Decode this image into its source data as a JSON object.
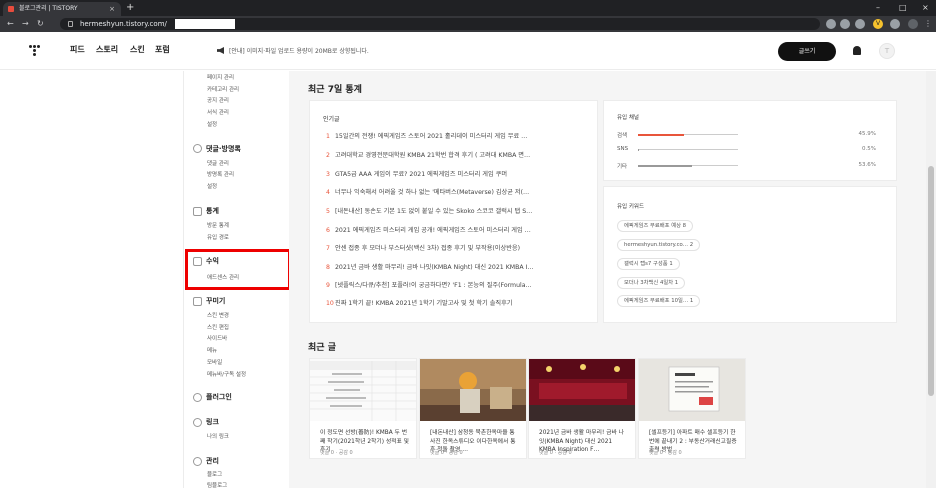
{
  "browser": {
    "tab_title": "블로그관리 | TISTORY",
    "tab_close": "×",
    "new_tab": "+",
    "url": "hermeshyun.tistory.com/",
    "win_min": "–",
    "win_max": "□",
    "win_close": "×"
  },
  "nav": {
    "items": [
      "피드",
      "스토리",
      "스킨",
      "포럼"
    ],
    "notice": "[안내] 이미지·파일 업로드 용량이 20MB로 상향됩니다.",
    "write_label": "글쓰기",
    "avatar_text": "T"
  },
  "sidebar": {
    "top_items": [
      "페이지 관리",
      "카테고리 관리",
      "공지 관리",
      "서식 관리",
      "설정"
    ],
    "comments": {
      "title": "댓글·방명록",
      "items": [
        "댓글 관리",
        "방명록 관리",
        "설정"
      ]
    },
    "stats": {
      "title": "통계",
      "items": [
        "방문 통계",
        "유입 경로"
      ]
    },
    "revenue": {
      "title": "수익",
      "items": [
        "애드센스 관리"
      ]
    },
    "decorate": {
      "title": "꾸미기",
      "items": [
        "스킨 변경",
        "스킨 편집",
        "사이드바",
        "메뉴",
        "모바일",
        "메뉴바/구독 설정"
      ]
    },
    "plugin": {
      "title": "플러그인"
    },
    "link": {
      "title": "링크",
      "items": [
        "나의 링크"
      ]
    },
    "manage": {
      "title": "관리",
      "items": [
        "블로그",
        "팀블로그"
      ]
    }
  },
  "stats_section": {
    "title": "최근 7일 통계",
    "popular_title": "인기글",
    "popular": [
      "15일간의 전쟁! 에픽게임즈 스토어 2021 홀리데이 미스터리 게임 무료 …",
      "고려대학교 경영전문대학원 KMBA 21학번 합격 후기 ( 고려대 KMBA 면…",
      "GTA5급 AAA 게임이 무료? 2021 에픽게임즈 미스터리 게임 쿠머",
      "너무나 익숙해서 어려울 것 하나 없는 '메타버스(Metaverse) 김상균 저(…",
      "[내돈내산] 동손도 기본 1도 없이 붙일 수 있는 Skoko 스코코 갤럭시 탭 S…",
      "2021 에픽게임즈 미스터리 게임 공개! 에픽게임즈 스토어 미스터리 게임 …",
      "안센 접종 후 모더나 부스터샷(백신 3차) 접종 후기 및 부작용(이상반응)",
      "2021년 금바 생활 마무리! 금바 나잇(KMBA Night) 대신 2021 KMBA I…",
      "[넷플릭스/다큐/추천] 포플러!이 궁금하다면? 'F1 : 본능의 질주(Formula…",
      "진짜 1학기 끝! KMBA 2021년 1학기 기말고사 및 첫 학기 솔직후기"
    ],
    "inflow_title": "유입 채널",
    "inflow": [
      {
        "label": "검색",
        "pct": "45.9%",
        "value": 45.9,
        "color": "#e8553b"
      },
      {
        "label": "SNS",
        "pct": "0.5%",
        "value": 0.5,
        "color": "#999999"
      },
      {
        "label": "기타",
        "pct": "53.6%",
        "value": 53.6,
        "color": "#999999"
      }
    ],
    "keywords_title": "유입 키워드",
    "keywords": [
      {
        "word": "에픽게임즈 무료배포 예상",
        "count": "8"
      },
      {
        "word": "hermeshyun.tistory.co…",
        "count": "2"
      },
      {
        "word": "갤럭시 탭s7 구성품",
        "count": "1"
      },
      {
        "word": "모더나 3차백신 4일차",
        "count": "1"
      },
      {
        "word": "에픽게임즈 무료배포 10일…",
        "count": "1"
      }
    ]
  },
  "recent_section": {
    "title": "최근 글",
    "posts": [
      {
        "title": "이 정도면 선방(善防)! KMBA 두 번째 학기(2021학년 2학기) 성적표 및 후기",
        "meta": "댓글 0 · 공감 0"
      },
      {
        "title": "[내돈내산] 삼청동 북촌한옥마을 통사진 한옥스튜디오 이다한옥에서 통후 첫돌 촬영 …",
        "meta": "댓글 0 · 공감 0"
      },
      {
        "title": "2021년 금바 생활 마무리! 금바 나잇(KMBA Night) 대신 2021 KMBA Inspiration F…",
        "meta": "댓글 0 · 공감 0"
      },
      {
        "title": "[셀프등기] 아파트 매수 셀프등기 한 번에 끝내기 2 : 부동산거래신고필증 출력 방법",
        "meta": "댓글 0 · 공감 0"
      }
    ]
  },
  "colors": {
    "accent": "#e8553b",
    "highlight": "#ee0000"
  }
}
